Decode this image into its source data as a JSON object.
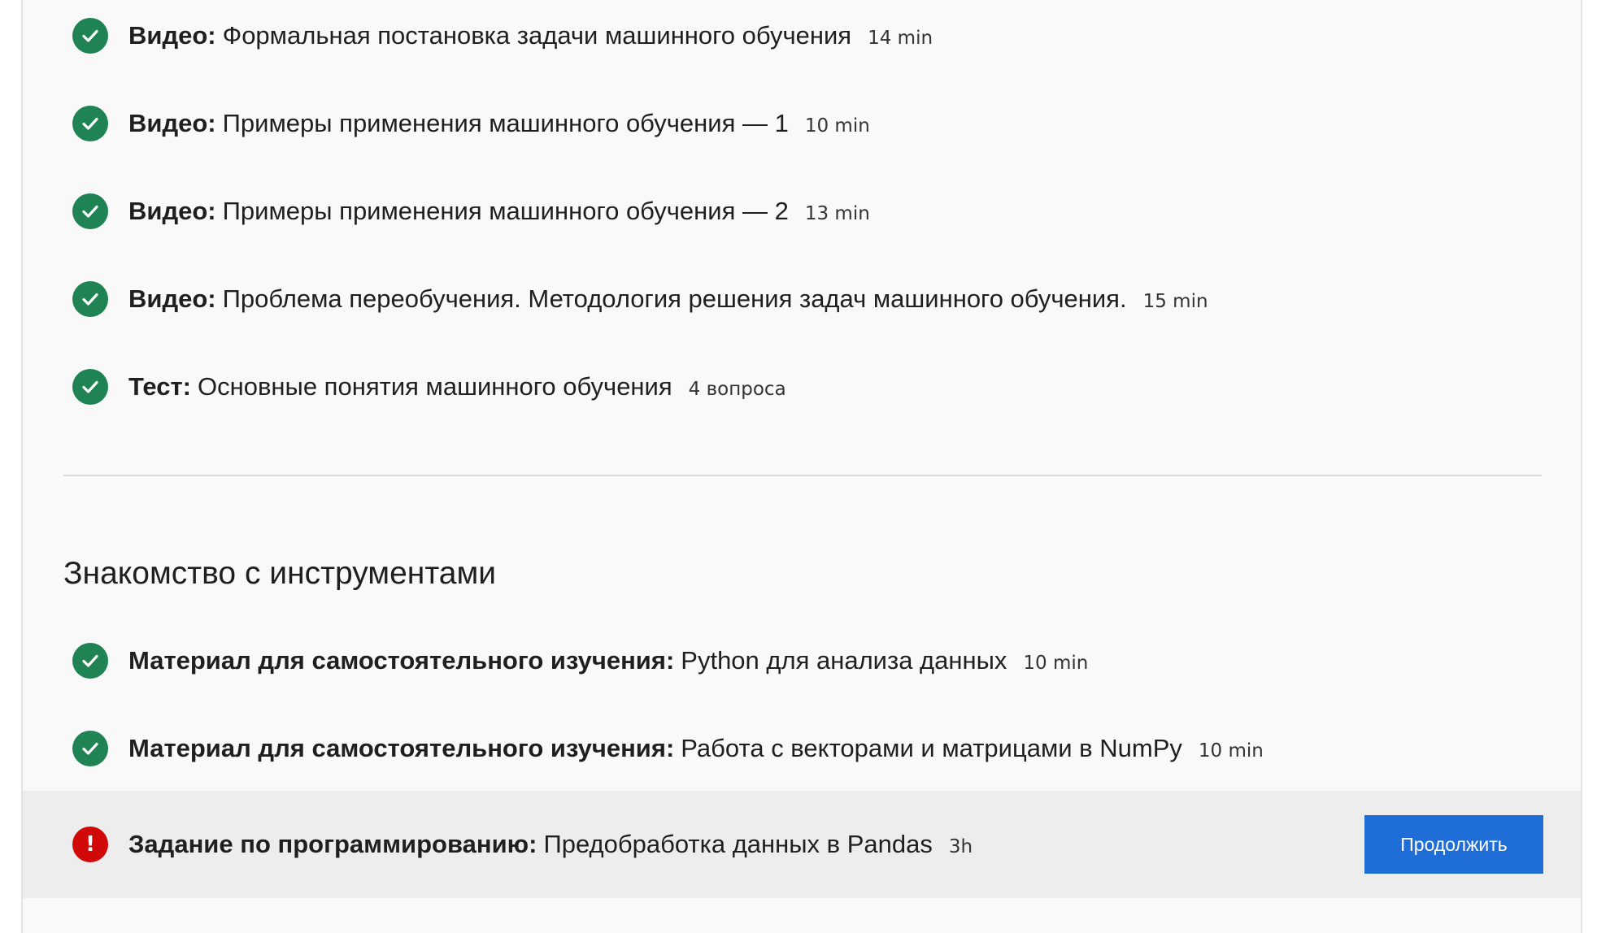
{
  "lessons": [
    {
      "type": "Видео:",
      "title": "Формальная постановка задачи машинного обучения",
      "meta": "14 min",
      "status": "completed"
    },
    {
      "type": "Видео:",
      "title": "Примеры применения машинного обучения — 1",
      "meta": "10 min",
      "status": "completed"
    },
    {
      "type": "Видео:",
      "title": "Примеры применения машинного обучения — 2",
      "meta": "13 min",
      "status": "completed"
    },
    {
      "type": "Видео:",
      "title": "Проблема переобучения. Методология решения задач машинного обучения.",
      "meta": "15 min",
      "status": "completed"
    },
    {
      "type": "Тест:",
      "title": "Основные понятия машинного обучения",
      "meta": "4 вопроса",
      "status": "completed"
    }
  ],
  "section": {
    "title": "Знакомство с инструментами",
    "items": [
      {
        "type": "Материал для самостоятельного изучения:",
        "title": "Python для анализа данных",
        "meta": "10 min",
        "status": "completed"
      },
      {
        "type": "Материал для самостоятельного изучения:",
        "title": "Работа с векторами и матрицами в NumPy",
        "meta": "10 min",
        "status": "completed"
      },
      {
        "type": "Задание по программированию:",
        "title": "Предобработка данных в Pandas",
        "meta": "3h",
        "status": "overdue",
        "button_label": "Продолжить"
      }
    ]
  },
  "colors": {
    "completed": "#1f8354",
    "overdue": "#d10808",
    "primary_button": "#1f6dd6"
  },
  "icons": {
    "completed": "checkmark-circle-icon",
    "overdue": "exclamation-circle-icon"
  }
}
